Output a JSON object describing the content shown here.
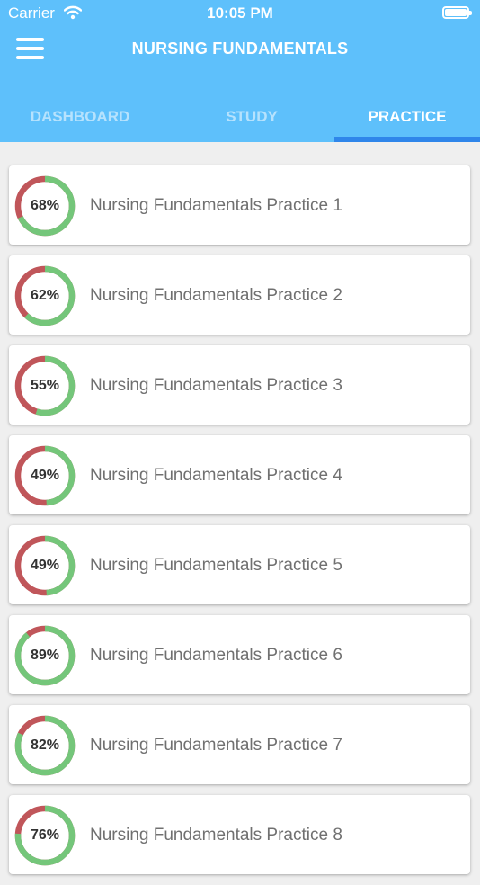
{
  "status_bar": {
    "carrier": "Carrier",
    "time": "10:05 PM"
  },
  "header": {
    "title": "NURSING FUNDAMENTALS",
    "menu_icon": "hamburger-menu-icon"
  },
  "tabs": [
    {
      "label": "DASHBOARD",
      "active": false
    },
    {
      "label": "STUDY",
      "active": false
    },
    {
      "label": "PRACTICE",
      "active": true
    }
  ],
  "colors": {
    "header": "#5ec0fb",
    "tab_indicator": "#2f86ea",
    "correct": "#74c67a",
    "incorrect": "#c0565a"
  },
  "practice_items": [
    {
      "title": "Nursing Fundamentals Practice 1",
      "percent_label": "68%",
      "percent": 68
    },
    {
      "title": "Nursing Fundamentals Practice 2",
      "percent_label": "62%",
      "percent": 62
    },
    {
      "title": "Nursing Fundamentals Practice 3",
      "percent_label": "55%",
      "percent": 55
    },
    {
      "title": "Nursing Fundamentals Practice 4",
      "percent_label": "49%",
      "percent": 49
    },
    {
      "title": "Nursing Fundamentals Practice 5",
      "percent_label": "49%",
      "percent": 49
    },
    {
      "title": "Nursing Fundamentals Practice 6",
      "percent_label": "89%",
      "percent": 89
    },
    {
      "title": "Nursing Fundamentals Practice 7",
      "percent_label": "82%",
      "percent": 82
    },
    {
      "title": "Nursing Fundamentals Practice 8",
      "percent_label": "76%",
      "percent": 76
    }
  ]
}
